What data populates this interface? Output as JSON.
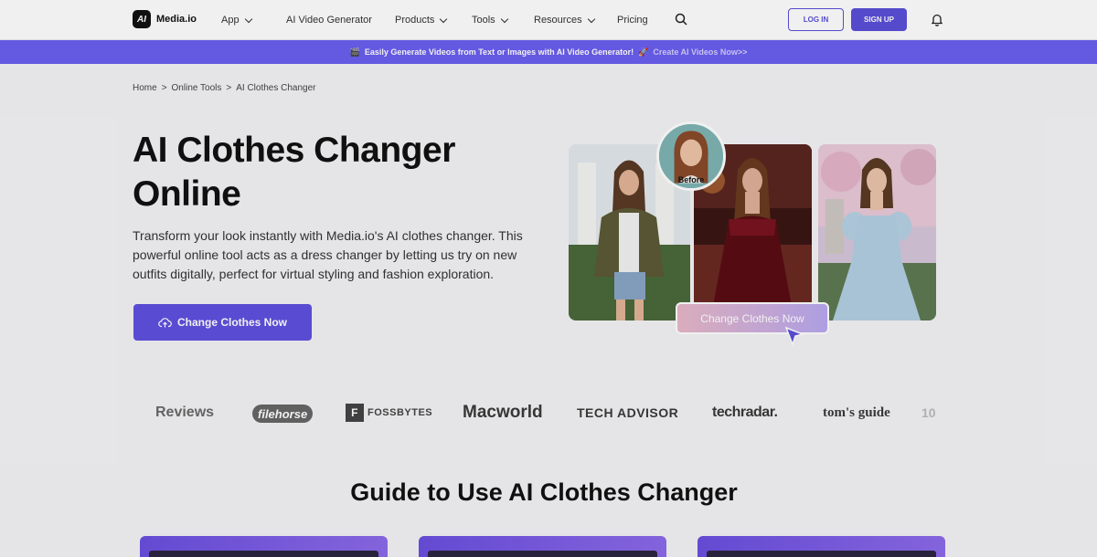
{
  "header": {
    "brand": "Media.io",
    "logo_mark": "AI",
    "nav": [
      {
        "label": "App",
        "has_dropdown": true
      },
      {
        "label": "AI Video Generator",
        "has_dropdown": false
      },
      {
        "label": "Products",
        "has_dropdown": true
      },
      {
        "label": "Tools",
        "has_dropdown": true
      },
      {
        "label": "Resources",
        "has_dropdown": true
      },
      {
        "label": "Pricing",
        "has_dropdown": false
      }
    ],
    "login_label": "LOG IN",
    "signup_label": "SIGN UP",
    "icons": [
      "search-icon",
      "bell-icon"
    ]
  },
  "banner": {
    "text": "Easily Generate Videos from Text or Images with AI Video Generator!",
    "cta": "Create AI Videos Now>>",
    "icons": [
      "clapper-icon",
      "rocket-icon"
    ]
  },
  "breadcrumb": [
    "Home",
    ">",
    "Online Tools",
    ">",
    "AI Clothes Changer"
  ],
  "hero": {
    "title": "AI Clothes Changer Online",
    "description": "Transform your look instantly with Media.io's AI clothes changer. This powerful online tool acts as a dress changer by letting us try on new outfits digitally, perfect for virtual styling and fashion exploration.",
    "cta_label": "Change Clothes Now",
    "before_label": "Before",
    "demo_button_label": "Change Clothes Now"
  },
  "press_logos": [
    "Reviews",
    "filehorse",
    "FOSSBYTES",
    "Macworld",
    "TECH ADVISOR",
    "techradar.",
    "tom's guide",
    "10"
  ],
  "guide": {
    "title": "Guide to Use AI Clothes Changer"
  },
  "colors": {
    "accent": "#5f50e0",
    "banner": "#6b5ff0",
    "background": "#f4f4f6"
  }
}
